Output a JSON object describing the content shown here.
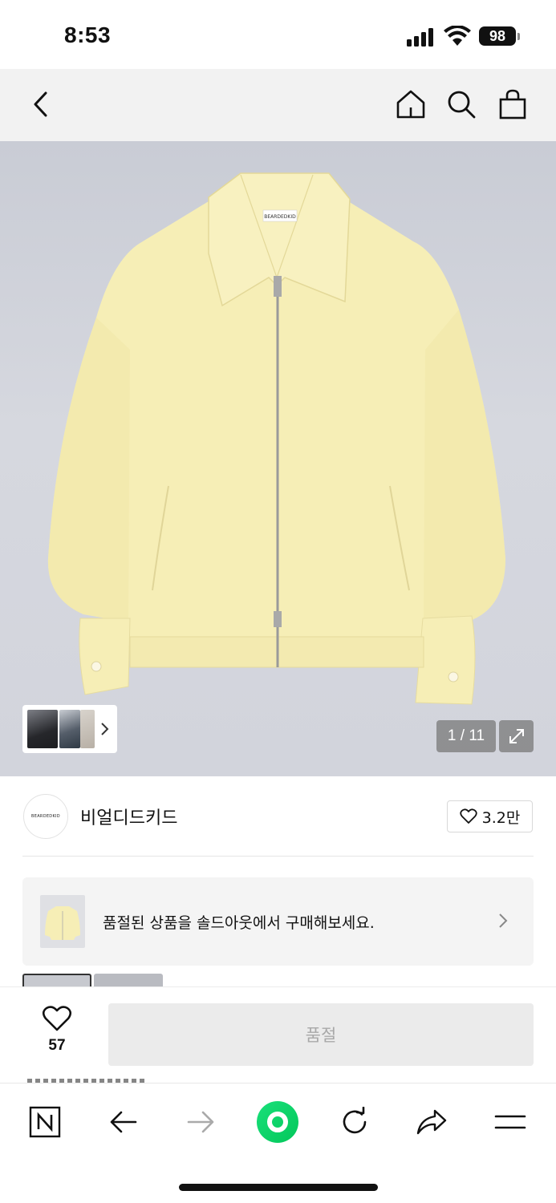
{
  "status_bar": {
    "time": "8:53",
    "battery": "98"
  },
  "header": {
    "icons": [
      "back-icon",
      "home-icon",
      "search-icon",
      "shopping-bag-icon"
    ]
  },
  "product_image": {
    "alt_icon": "jacket-image",
    "counter": "1 / 11",
    "expand_icon": "expand-icon"
  },
  "brand": {
    "logo_text": "BEARDEDKID",
    "name": "비얼디드키드",
    "likes": "3.2만"
  },
  "banner": {
    "text": "품절된 상품을 솔드아웃에서 구매해보세요."
  },
  "purchase": {
    "wish_count": "57",
    "button_label": "품절"
  },
  "browser_bar": {
    "icons": [
      "naver-n-icon",
      "back-arrow-icon",
      "forward-arrow-icon",
      "green-dot-icon",
      "refresh-icon",
      "share-icon",
      "menu-icon"
    ]
  },
  "colors": {
    "jacket": "#f7efb8",
    "background_image": "#d3d5dc",
    "soldout_button": "#ebebeb",
    "naver_green": "#03c75a"
  }
}
